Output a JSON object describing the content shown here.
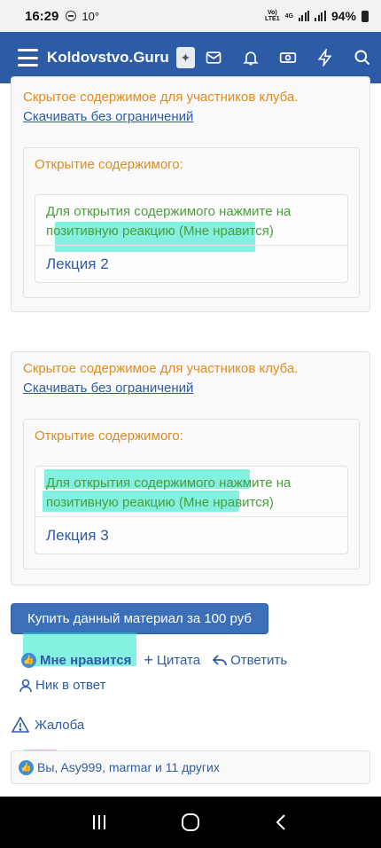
{
  "status": {
    "time": "16:29",
    "temperature": "10°",
    "network_top": "Vo)",
    "network_bottom": "LTE1",
    "network_type": "4G",
    "battery": "94%"
  },
  "navbar": {
    "brand": "Koldovstvo.Guru",
    "icons": [
      "mail-icon",
      "bell-icon",
      "money-icon",
      "lightning-icon",
      "search-icon"
    ]
  },
  "blocks": [
    {
      "hidden_title": "Скрытое содержимое для участников клуба.",
      "hidden_link": "Скачивать без ограничений",
      "inner_title": "Открытие содержимого:",
      "unlock_text": "Для открытия содержимого нажмите на позитивную реакцию (Мне нравится)",
      "lecture": "Лекция 2"
    },
    {
      "hidden_title": "Скрытое содержимое для участников клуба.",
      "hidden_link": "Скачивать без ограничений",
      "inner_title": "Открытие содержимого:",
      "unlock_text": "Для открытия содержимого нажмите на позитивную реакцию (Мне нравится)",
      "lecture": "Лекция 3"
    }
  ],
  "buy_button": "Купить данный материал за 100 руб",
  "actions": {
    "like": "Мне нравится",
    "quote": "Цитата",
    "reply": "Ответить",
    "nick_reply": "Ник в ответ",
    "report": "Жалоба"
  },
  "likes": {
    "you": "Вы",
    "others": ", Asy999, marmar и 11 других"
  },
  "colors": {
    "brand_blue": "#2d5ba6",
    "hidden_orange": "#e08c1f",
    "unlock_green": "#4a9e3b",
    "highlight_cyan": "#20e6c8"
  }
}
